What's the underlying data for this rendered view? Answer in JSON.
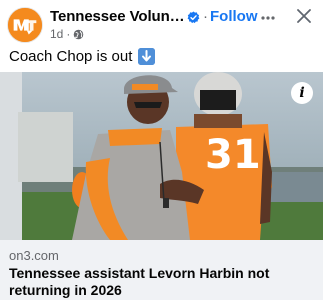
{
  "post": {
    "page_name": "Tennessee Volunteers",
    "follow_label": "Follow",
    "separator": "·",
    "time": "1d",
    "meta_separator": "·",
    "text": "Coach Chop is out"
  },
  "link": {
    "domain": "on3.com",
    "title": "Tennessee assistant Levorn Harbin not returning in 2026",
    "info_label": "i",
    "jersey_number": "31"
  },
  "colors": {
    "brand_orange": "#f48a1e",
    "follow_blue": "#1877f2",
    "verified_blue": "#1877f2"
  },
  "icons": {
    "verified": "verified-badge-icon",
    "more": "more-options-icon",
    "close": "close-icon",
    "audience": "globe-icon",
    "emoji": "down-arrow-emoji-icon",
    "info": "info-icon"
  }
}
